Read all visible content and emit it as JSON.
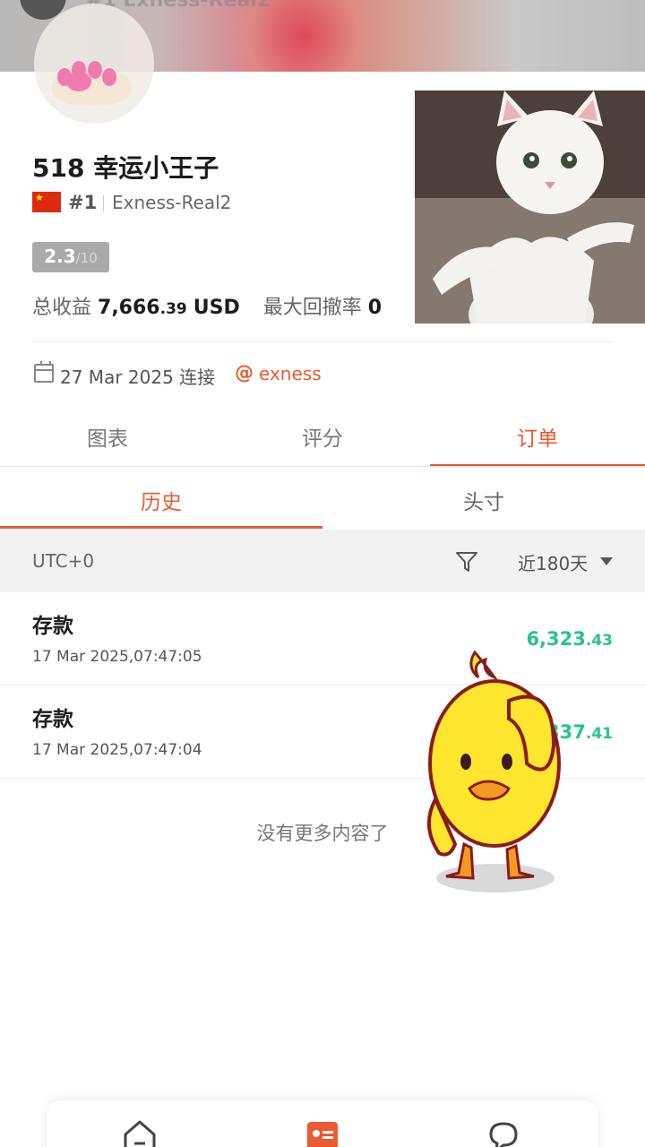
{
  "header": {
    "blurred_title": "#1 Exness-Real2"
  },
  "profile": {
    "name": "518 幸运小王子",
    "rank": "#1",
    "account": "Exness-Real2",
    "score": "2.3",
    "score_max": "/10",
    "total_return_label": "总收益",
    "total_return_int": "7,666",
    "total_return_dec": ".39",
    "total_return_currency": "USD",
    "max_drawdown_label": "最大回撤率",
    "max_drawdown_value": "0",
    "connected_date": "27 Mar 2025 连接",
    "broker": "exness"
  },
  "tabs": {
    "items": [
      {
        "label": "图表"
      },
      {
        "label": "评分"
      },
      {
        "label": "订单"
      }
    ],
    "active": "订单"
  },
  "sub_tabs": {
    "items": [
      {
        "label": "历史"
      },
      {
        "label": "头寸"
      }
    ],
    "active": "历史"
  },
  "filter": {
    "timezone": "UTC+0",
    "range": "近180天"
  },
  "orders": [
    {
      "type": "存款",
      "time": "17 Mar 2025,07:47:05",
      "amount_int": "6,323",
      "amount_dec": ".43"
    },
    {
      "type": "存款",
      "time": "17 Mar 2025,07:47:04",
      "amount_int": "337",
      "amount_dec": ".41"
    }
  ],
  "end_message": "没有更多内容了",
  "colors": {
    "accent": "#ea5a33",
    "positive": "#26c58a",
    "muted": "#777777"
  },
  "icons": {
    "nav": [
      "home-icon",
      "profile-card-icon",
      "chat-icon"
    ]
  }
}
